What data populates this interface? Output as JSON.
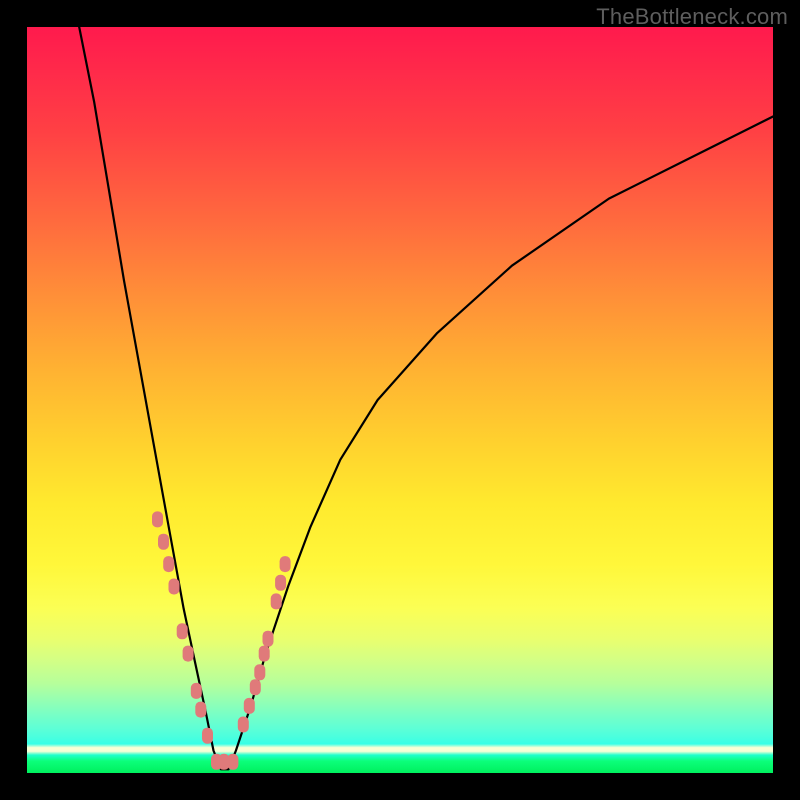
{
  "watermark": "TheBottleneck.com",
  "colors": {
    "frame": "#000000",
    "curve_stroke": "#000000",
    "marker_fill": "#e07a7a",
    "marker_stroke": "#c96a6a"
  },
  "chart_data": {
    "type": "line",
    "title": "",
    "xlabel": "",
    "ylabel": "",
    "xlim": [
      0,
      100
    ],
    "ylim": [
      0,
      100
    ],
    "note": "Axes are unlabeled; values are pixel-space estimates normalized to 0–100 within the plot area. The V-shaped curve plunges from top-left to a minimum near x≈26 at the floor (y≈0), then rises gradually toward the upper right. Salmon-colored markers cluster along both arms of the V near the bottom and across the floor.",
    "series": [
      {
        "name": "curve",
        "x": [
          7,
          9,
          11,
          13,
          15,
          17,
          19,
          21,
          22.5,
          24,
          25,
          26,
          27,
          28,
          30,
          32,
          35,
          38,
          42,
          47,
          55,
          65,
          78,
          92,
          100
        ],
        "y": [
          100,
          90,
          78,
          66,
          55,
          44,
          33,
          22,
          15,
          8,
          3,
          0.5,
          0.5,
          3,
          9,
          16,
          25,
          33,
          42,
          50,
          59,
          68,
          77,
          84,
          88
        ]
      },
      {
        "name": "markers",
        "x": [
          17.5,
          18.3,
          19.0,
          19.7,
          20.8,
          21.6,
          22.7,
          23.3,
          24.2,
          25.4,
          26.4,
          27.6,
          29.0,
          29.8,
          30.6,
          31.2,
          31.8,
          32.3,
          33.4,
          34.0,
          34.6
        ],
        "y": [
          34,
          31,
          28,
          25,
          19,
          16,
          11,
          8.5,
          5,
          1.5,
          1.5,
          1.5,
          6.5,
          9,
          11.5,
          13.5,
          16,
          18,
          23,
          25.5,
          28
        ]
      }
    ]
  }
}
